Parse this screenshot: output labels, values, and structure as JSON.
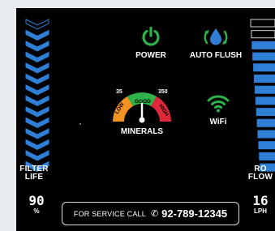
{
  "panel": {
    "accent_color": "#2f7fd6",
    "filter_life": {
      "label_line1": "FILTER",
      "label_line2": "LIFE",
      "value": "90",
      "unit": "%",
      "level": 0.9
    },
    "ro_flow": {
      "label_line1": "RO",
      "label_line2": "FLOW",
      "value": "16",
      "unit": "LPH",
      "level": 0.85
    }
  },
  "controls": {
    "power": {
      "label": "POWER",
      "color": "#2fb24a",
      "icon": "power-icon"
    },
    "auto_flush": {
      "label": "AUTO FLUSH",
      "color": "#2f7fd6",
      "icon": "water-drop-cycle-icon"
    },
    "minerals": {
      "label": "MINERALS",
      "icon": "minerals-gauge-icon",
      "min_value": "35",
      "max_value": "350",
      "zone_low": "LOW",
      "zone_good": "GOOD",
      "zone_high": "HIGH",
      "colors": {
        "low": "#f39220",
        "good": "#2fb24a",
        "high": "#e0283a"
      }
    },
    "wifi": {
      "label": "WiFi",
      "color": "#2fb24a",
      "icon": "wifi-icon"
    }
  },
  "service": {
    "prefix": "FOR SERVICE CALL",
    "phone_icon": "phone-icon",
    "phone": "92-789-12345"
  }
}
